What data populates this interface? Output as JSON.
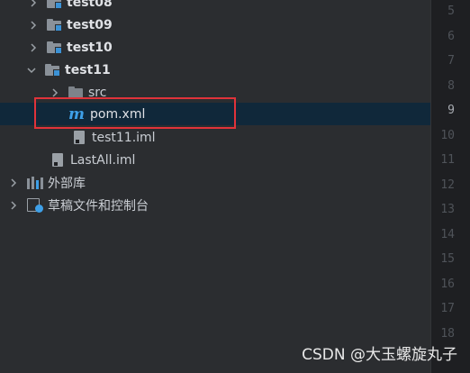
{
  "tree": {
    "items": [
      {
        "label": "test08"
      },
      {
        "label": "test09"
      },
      {
        "label": "test10"
      },
      {
        "label": "test11"
      },
      {
        "label": "src"
      },
      {
        "label": "pom.xml"
      },
      {
        "label": "test11.iml"
      },
      {
        "label": "LastAll.iml"
      },
      {
        "label": "外部库"
      },
      {
        "label": "草稿文件和控制台"
      }
    ]
  },
  "gutter": {
    "line_numbers": [
      "5",
      "6",
      "7",
      "8",
      "9",
      "10",
      "11",
      "12",
      "13",
      "14",
      "15",
      "16",
      "17",
      "18"
    ],
    "active_line": "9"
  },
  "watermark": "CSDN @大玉螺旋丸子",
  "colors": {
    "selection": "#10283a",
    "highlight_border": "#e0333a",
    "maven_icon": "#3ea0e8"
  }
}
